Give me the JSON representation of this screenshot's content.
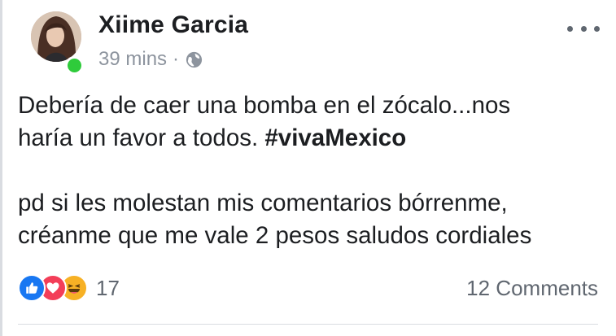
{
  "post": {
    "author_name": "Xiime Garcia",
    "timestamp": "39 mins",
    "separator": "·",
    "privacy_icon": "globe-icon",
    "more_icon": "more-options-icon",
    "text": {
      "line1": "Debería de caer una bomba en el zócalo...nos",
      "line2_prefix": "haría un favor a todos. ",
      "hashtag": "#vivaMexico",
      "line3": "pd si les molestan mis comentarios bórrenme,",
      "line4": "créanme que me vale 2 pesos  saludos cordiales"
    },
    "reactions": {
      "icons": [
        "like-reaction-icon",
        "love-reaction-icon",
        "haha-reaction-icon"
      ],
      "count": "17"
    },
    "comments_label": "12 Comments"
  },
  "colors": {
    "online": "#2fcb3b",
    "like": "#1877f2",
    "love": "#f33e58",
    "haha": "#f7b125",
    "text": "#1c1e21",
    "secondary": "#606770"
  }
}
